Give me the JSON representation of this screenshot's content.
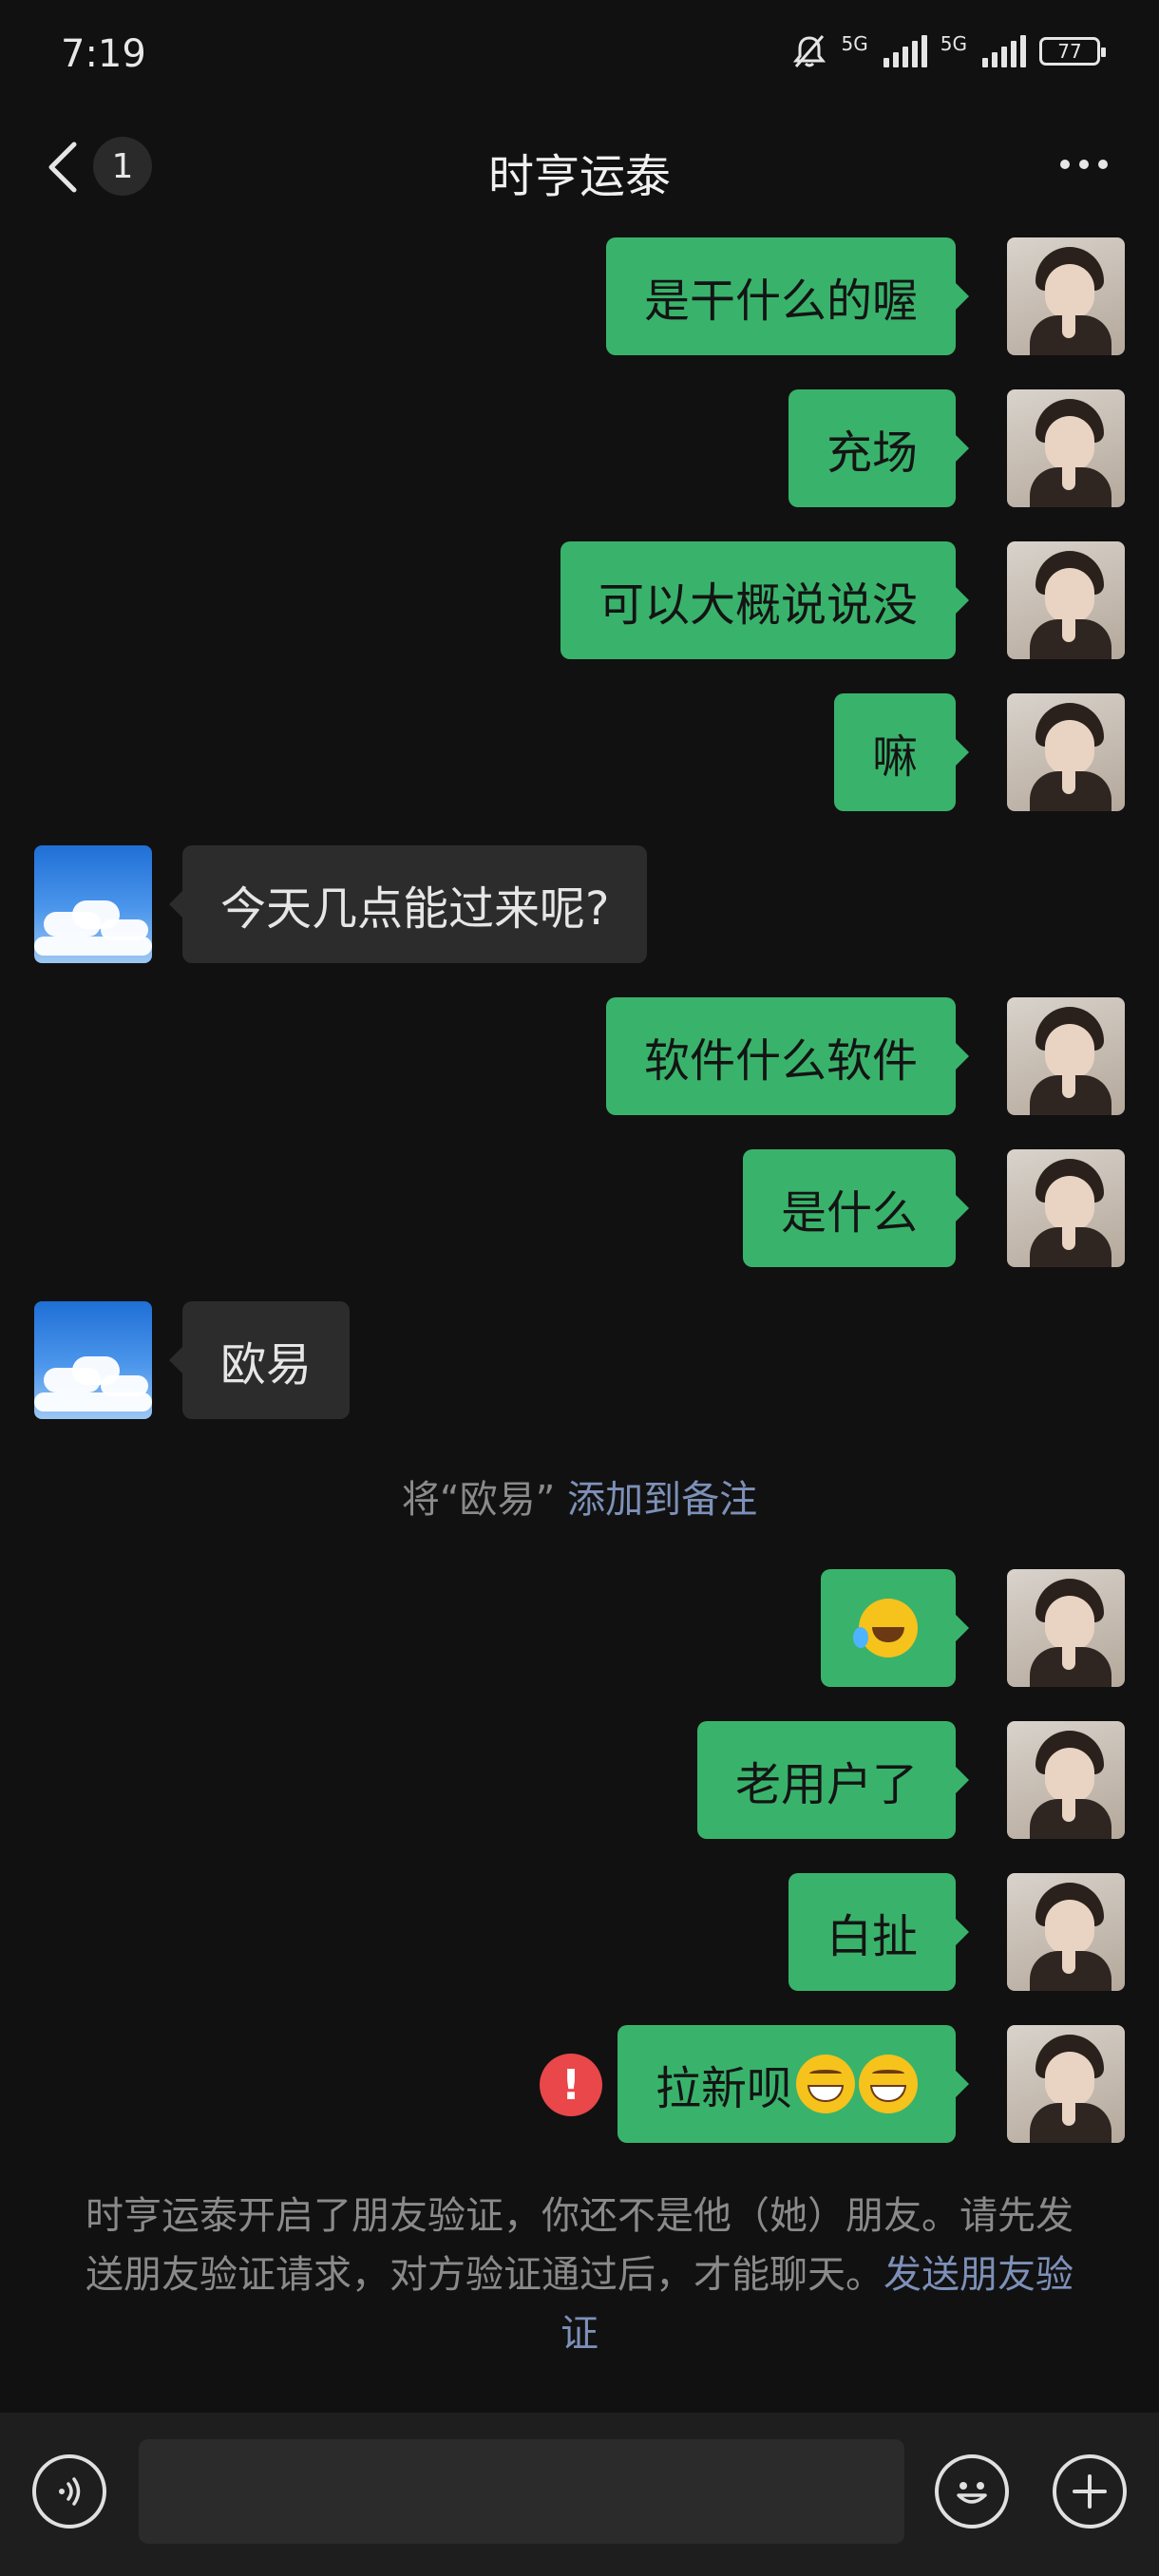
{
  "status_bar": {
    "time": "7:19",
    "network1": "5G",
    "network2": "5G",
    "battery": "77"
  },
  "nav": {
    "unread_count": "1",
    "title": "时亨运泰"
  },
  "messages": [
    {
      "side": "out",
      "text": "是干什么的喔"
    },
    {
      "side": "out",
      "text": "充场"
    },
    {
      "side": "out",
      "text": "可以大概说说没"
    },
    {
      "side": "out",
      "text": "嘛"
    },
    {
      "side": "in",
      "text": "今天几点能过来呢?"
    },
    {
      "side": "out",
      "text": "软件什么软件"
    },
    {
      "side": "out",
      "text": "是什么"
    },
    {
      "side": "in",
      "text": "欧易"
    },
    {
      "side": "out",
      "text": "",
      "emoji": "laugh-cry"
    },
    {
      "side": "out",
      "text": "老用户了"
    },
    {
      "side": "out",
      "text": "白扯"
    },
    {
      "side": "out",
      "text": "拉新呗",
      "emoji": "grin-x2",
      "failed": true
    }
  ],
  "remark_hint": {
    "prefix": "将“欧易”",
    "link": "添加到备注"
  },
  "verification_notice": {
    "text": "时亨运泰开启了朋友验证，你还不是他（她）朋友。请先发送朋友验证请求，对方验证通过后，才能聊天。",
    "link": "发送朋友验证"
  },
  "input": {
    "value": ""
  },
  "colors": {
    "background": "#111111",
    "outgoing_bubble": "#39b36b",
    "incoming_bubble": "#2c2c2c",
    "link": "#7d90b8",
    "error": "#e9474a"
  }
}
